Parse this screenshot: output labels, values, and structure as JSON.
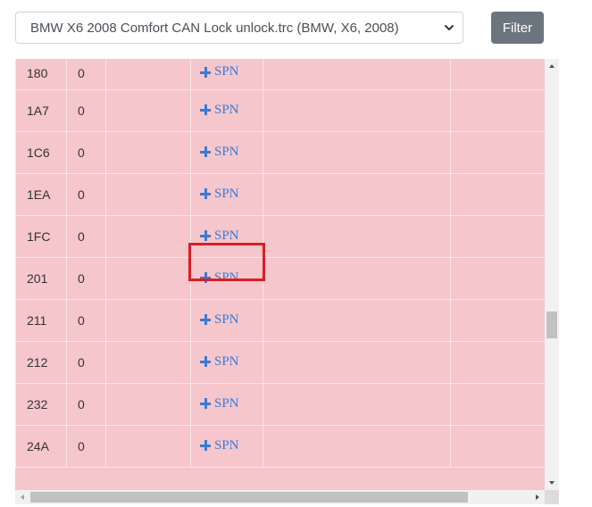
{
  "toolbar": {
    "file_select_value": "BMW X6 2008 Comfort CAN Lock unlock.trc (BMW, X6, 2008)",
    "filter_label": "Filter"
  },
  "table": {
    "rows": [
      {
        "id": "180",
        "value": "0",
        "spn_label": "SPN"
      },
      {
        "id": "1A7",
        "value": "0",
        "spn_label": "SPN"
      },
      {
        "id": "1C6",
        "value": "0",
        "spn_label": "SPN"
      },
      {
        "id": "1EA",
        "value": "0",
        "spn_label": "SPN"
      },
      {
        "id": "1FC",
        "value": "0",
        "spn_label": "SPN"
      },
      {
        "id": "201",
        "value": "0",
        "spn_label": "SPN"
      },
      {
        "id": "211",
        "value": "0",
        "spn_label": "SPN"
      },
      {
        "id": "212",
        "value": "0",
        "spn_label": "SPN"
      },
      {
        "id": "232",
        "value": "0",
        "spn_label": "SPN"
      },
      {
        "id": "24A",
        "value": "0",
        "spn_label": "SPN"
      }
    ],
    "highlighted_row": "1FC",
    "row_background": "#f5c6cb",
    "link_color": "#3a7bd5",
    "highlight_color": "#d81f26"
  },
  "icons": {
    "select_caret": "chevron-down-icon",
    "spn_add": "plus-icon"
  }
}
